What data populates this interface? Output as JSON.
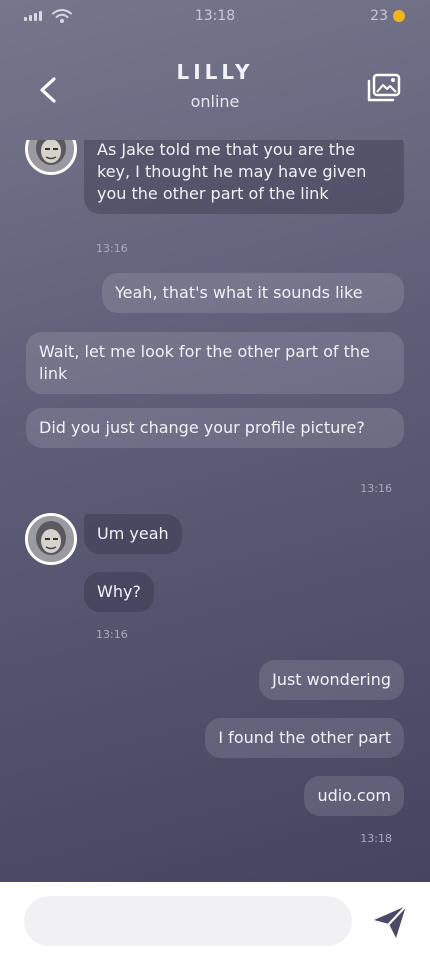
{
  "status_bar": {
    "time": "13:18",
    "battery": "23"
  },
  "header": {
    "title": "LILLY",
    "status": "online"
  },
  "messages": [
    {
      "side": "left",
      "text": "As Jake told me that you are the key, I thought he may have given you the other part of the link"
    },
    {
      "side": "time-left",
      "text": "13:16"
    },
    {
      "side": "right",
      "text": "Yeah, that's what it sounds like"
    },
    {
      "side": "right",
      "text": "Wait, let me look for the other part of the link"
    },
    {
      "side": "right",
      "text": "Did you just change your profile picture?"
    },
    {
      "side": "time-right",
      "text": "13:16"
    },
    {
      "side": "left",
      "text": "Um yeah"
    },
    {
      "side": "left",
      "text": "Why?"
    },
    {
      "side": "time-left",
      "text": "13:16"
    },
    {
      "side": "right",
      "text": "Just wondering"
    },
    {
      "side": "right",
      "text": "I found the other part"
    },
    {
      "side": "right",
      "text": "udio.com"
    },
    {
      "side": "time-right",
      "text": "13:18"
    }
  ],
  "composer": {
    "placeholder": ""
  },
  "colors": {
    "battery": "#f3b31a",
    "background_top": "#76768c",
    "background_bottom": "#454561"
  }
}
